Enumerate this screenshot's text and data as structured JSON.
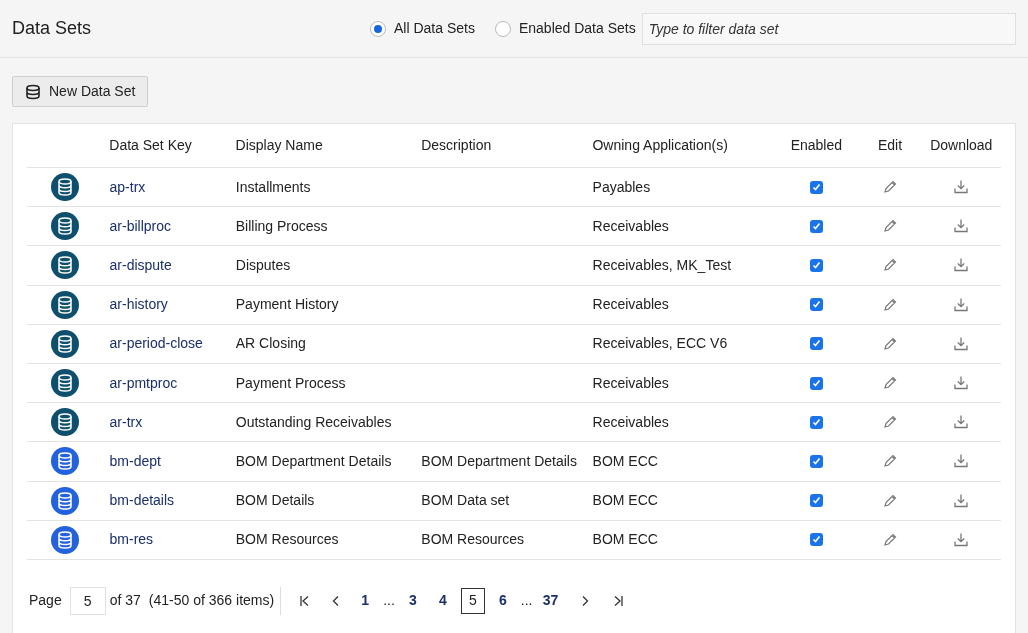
{
  "title": "Data Sets",
  "filter_options": [
    {
      "label": "All Data Sets",
      "selected": true
    },
    {
      "label": "Enabled Data Sets",
      "selected": false
    }
  ],
  "search": {
    "placeholder": "Type to filter data set"
  },
  "new_button": {
    "label": "New Data Set"
  },
  "table": {
    "columns": [
      "Data Set Key",
      "Display Name",
      "Description",
      "Owning Application(s)",
      "Enabled",
      "Edit",
      "Download"
    ],
    "rows": [
      {
        "key": "ap-trx",
        "display_name": "Installments",
        "owning": "Payables",
        "enabled": true,
        "color": "#0e4f6e"
      },
      {
        "key": "ar-billproc",
        "display_name": "Billing Process",
        "owning": "Receivables",
        "enabled": true,
        "color": "#0e4f6e"
      },
      {
        "key": "ar-dispute",
        "display_name": "Disputes",
        "owning": "Receivables, MK_Test",
        "enabled": true,
        "color": "#0e4f6e"
      },
      {
        "key": "ar-history",
        "display_name": "Payment History",
        "owning": "Receivables",
        "enabled": true,
        "color": "#0e4f6e"
      },
      {
        "key": "ar-period-close",
        "display_name": "AR Closing",
        "owning": "Receivables, ECC V6",
        "enabled": true,
        "color": "#0e4f6e"
      },
      {
        "key": "ar-pmtproc",
        "display_name": "Payment Process",
        "owning": "Receivables",
        "enabled": true,
        "color": "#0e4f6e"
      },
      {
        "key": "ar-trx",
        "display_name": "Outstanding Receivables",
        "owning": "Receivables",
        "enabled": true,
        "color": "#0e4f6e"
      },
      {
        "key": "bm-dept",
        "display_name": "BOM Department Details",
        "description": "BOM Department Details",
        "owning": "BOM ECC",
        "enabled": true,
        "color": "#2462dc"
      },
      {
        "key": "bm-details",
        "display_name": "BOM Details",
        "description": "BOM Data set",
        "owning": "BOM ECC",
        "enabled": true,
        "color": "#2462dc"
      },
      {
        "key": "bm-res",
        "display_name": "BOM Resources",
        "description": "BOM Resources",
        "owning": "BOM ECC",
        "enabled": true,
        "color": "#2462dc"
      }
    ]
  },
  "pagination": {
    "page_label": "Page",
    "page_value": "5",
    "of_label": "of 37",
    "range": "(41-50 of 366 items)",
    "pages": [
      {
        "kind": "page",
        "label": "1",
        "selected": false
      },
      {
        "kind": "ellipsis",
        "label": "..."
      },
      {
        "kind": "page",
        "label": "3",
        "selected": false
      },
      {
        "kind": "page",
        "label": "4",
        "selected": false
      },
      {
        "kind": "page",
        "label": "5",
        "selected": true
      },
      {
        "kind": "page",
        "label": "6",
        "selected": false
      },
      {
        "kind": "ellipsis",
        "label": "..."
      },
      {
        "kind": "page",
        "label": "37",
        "selected": false
      }
    ]
  }
}
